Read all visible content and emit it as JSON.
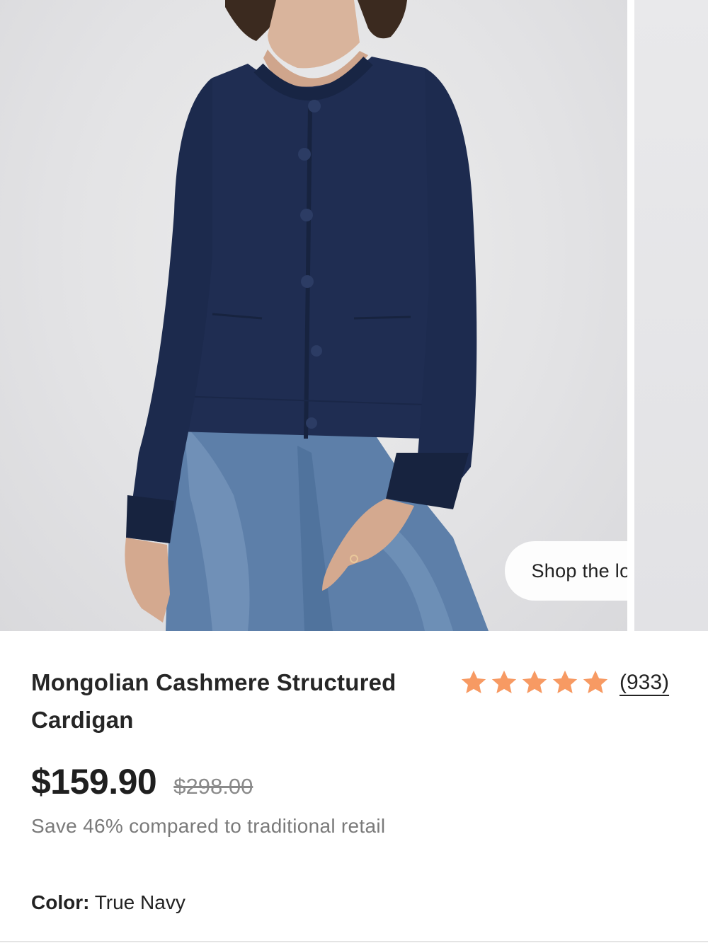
{
  "gallery": {
    "product_image_name": "woman-wearing-navy-cashmere-cardigan-and-jeans",
    "shop_the_look_label": "Shop the look"
  },
  "product": {
    "title": "Mongolian Cashmere Structured Cardigan",
    "rating": {
      "stars": 5,
      "max_stars": 5,
      "review_count_label": "(933)",
      "star_color": "#F79A63"
    },
    "price": "$159.90",
    "compare_at_price": "$298.00",
    "savings_text": "Save 46% compared to traditional retail",
    "color_label": "Color:",
    "color_value": "True Navy",
    "swatch_color": "#1E2D4F"
  }
}
